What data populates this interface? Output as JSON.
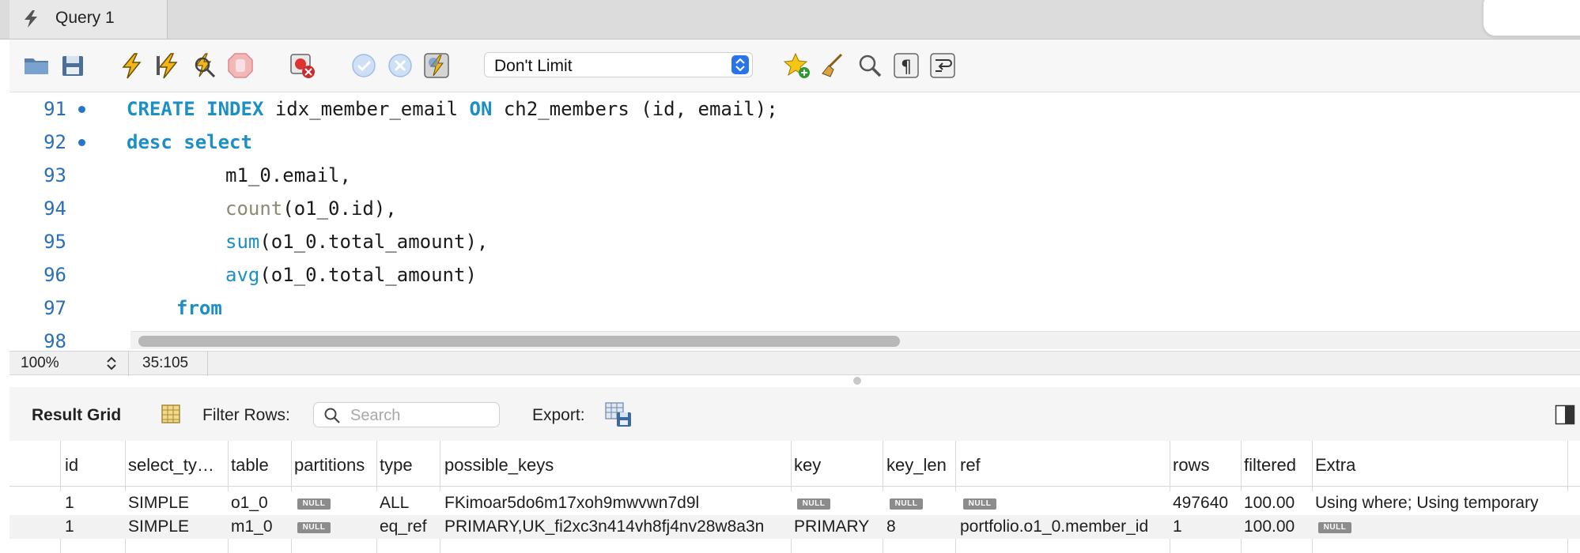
{
  "tab": {
    "title": "Query 1",
    "icon": "lightning-icon"
  },
  "toolbar": {
    "buttons": [
      {
        "name": "open-folder-icon"
      },
      {
        "name": "save-icon"
      },
      {
        "name": "execute-icon"
      },
      {
        "name": "execute-current-icon"
      },
      {
        "name": "explain-icon"
      },
      {
        "name": "stop-icon"
      },
      {
        "name": "toggle-error-stop-icon"
      },
      {
        "name": "commit-icon"
      },
      {
        "name": "rollback-icon"
      },
      {
        "name": "autocommit-icon"
      },
      {
        "name": "bookmark-icon"
      },
      {
        "name": "beautify-icon"
      },
      {
        "name": "find-icon"
      },
      {
        "name": "invisible-chars-icon"
      },
      {
        "name": "wrap-icon"
      }
    ],
    "limit": "Don't Limit"
  },
  "editor": {
    "lines": [
      {
        "num": "91",
        "dot": true
      },
      {
        "num": "92",
        "dot": true
      },
      {
        "num": "93",
        "dot": false
      },
      {
        "num": "94",
        "dot": false
      },
      {
        "num": "95",
        "dot": false
      },
      {
        "num": "96",
        "dot": false
      },
      {
        "num": "97",
        "dot": false
      },
      {
        "num": "98",
        "dot": false
      }
    ],
    "tokens": {
      "l91": [
        "CREATE",
        " ",
        "INDEX",
        " idx_member_email ",
        "ON",
        " ch2_members (id, email);"
      ],
      "l92": [
        "desc",
        " ",
        "select"
      ],
      "l93": "m1_0.email,",
      "l94": [
        "count",
        "(o1_0.id),"
      ],
      "l95": [
        "sum",
        "(o1_0.total_amount),"
      ],
      "l96": [
        "avg",
        "(o1_0.total_amount)"
      ],
      "l97": "from"
    }
  },
  "status": {
    "zoom": "100%",
    "cursor": "35:105"
  },
  "results": {
    "label": "Result Grid",
    "filter_label": "Filter Rows:",
    "search_placeholder": "Search",
    "export_label": "Export:",
    "null_text": "NULL",
    "columns": [
      "id",
      "select_ty…",
      "table",
      "partitions",
      "type",
      "possible_keys",
      "key",
      "key_len",
      "ref",
      "rows",
      "filtered",
      "Extra"
    ],
    "rows": [
      [
        "1",
        "SIMPLE",
        "o1_0",
        null,
        "ALL",
        "FKimoar5do6m17xoh9mwvwn7d9l",
        null,
        null,
        null,
        "497640",
        "100.00",
        "Using where; Using temporary"
      ],
      [
        "1",
        "SIMPLE",
        "m1_0",
        null,
        "eq_ref",
        "PRIMARY,UK_fi2xc3n414vh8fj4nv28w8a3n",
        "PRIMARY",
        "8",
        "portfolio.o1_0.member_id",
        "1",
        "100.00",
        null
      ]
    ]
  }
}
